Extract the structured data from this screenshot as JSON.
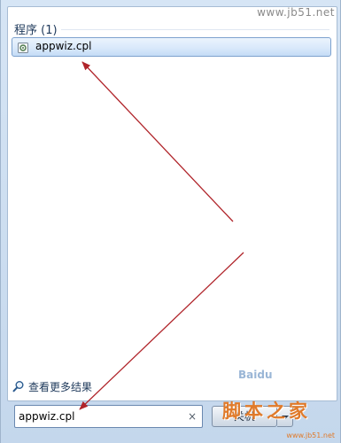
{
  "results": {
    "group_title": "程序 (1)",
    "items": [
      {
        "label": "appwiz.cpl",
        "icon": "control-panel-applet-icon"
      }
    ],
    "see_more_label": "查看更多结果",
    "see_more_icon": "magnifier-icon"
  },
  "search": {
    "value": "appwiz.cpl",
    "clear_glyph": "×"
  },
  "shutdown": {
    "label": "关机"
  },
  "watermarks": {
    "site_url": "www.jb51.net",
    "brand_text": "脚本之家",
    "brand_url": "www.jb51.net",
    "faint_mark": "Baidu"
  },
  "colors": {
    "selection_border": "#7da2ce",
    "annotation_arrow": "#b0242a",
    "brand": "#e07a2a"
  }
}
